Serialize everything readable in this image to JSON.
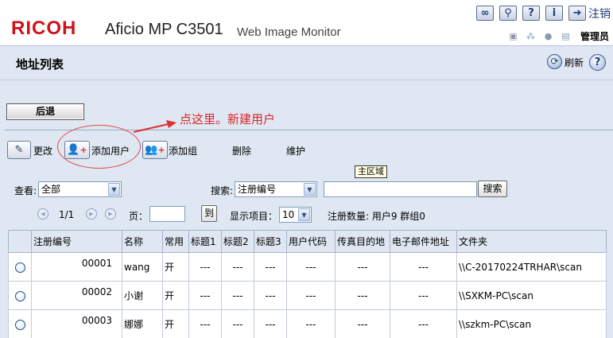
{
  "header": {
    "brand": "RICOH",
    "model": "Aficio MP C3501",
    "product": "Web Image Monitor",
    "top_buttons": [
      "link-icon",
      "search-icon",
      "help-icon",
      "info-icon",
      "logout-icon"
    ],
    "top_button_glyphs": [
      "∞",
      "⚲",
      "?",
      "i",
      "➜"
    ],
    "logout_label": "注销",
    "status_icons": [
      "lock-icon",
      "network-icon",
      "user-icon",
      "document-icon"
    ],
    "admin_label": "管理员"
  },
  "page": {
    "title": "地址列表",
    "refresh_label": "刷新",
    "back_label": "后退"
  },
  "annotation": {
    "text": "点这里。新建用户",
    "color": "#d8262a"
  },
  "toolbar": {
    "edit_label": "更改",
    "add_user_label": "添加用户",
    "add_group_label": "添加组",
    "delete_label": "删除",
    "maintain_label": "维护"
  },
  "filter": {
    "view_label": "查看:",
    "view_value": "全部",
    "search_label": "搜索:",
    "search_by_value": "注册编号",
    "search_input_value": "",
    "search_button": "搜索",
    "tooltip": "主区域"
  },
  "pagination": {
    "page_text": "1/1",
    "page_label": "页：",
    "page_input_value": "",
    "go_button": "到",
    "display_label": "显示项目：",
    "display_value": "10",
    "count_label": "注册数量: 用户9  群组0"
  },
  "table": {
    "columns": [
      "",
      "注册编号",
      "名称",
      "常用",
      "标题1",
      "标题2",
      "标题3",
      "用户代码",
      "传真目的地",
      "电子邮件地址",
      "文件夹"
    ],
    "rows": [
      [
        "",
        "00001",
        "wang",
        "开",
        "---",
        "---",
        "---",
        "---",
        "---",
        "---",
        "\\\\C-20170224TRHAR\\scan"
      ],
      [
        "",
        "00002",
        "小谢",
        "开",
        "---",
        "---",
        "---",
        "---",
        "---",
        "---",
        "\\\\SXKM-PC\\scan"
      ],
      [
        "",
        "00003",
        "娜娜",
        "开",
        "---",
        "---",
        "---",
        "---",
        "---",
        "---",
        "\\\\szkm-PC\\scan"
      ]
    ]
  },
  "colors": {
    "brand_red": "#d0101a",
    "page_bg": "#dfe7f2",
    "accent_blue": "#1b3a7a"
  }
}
